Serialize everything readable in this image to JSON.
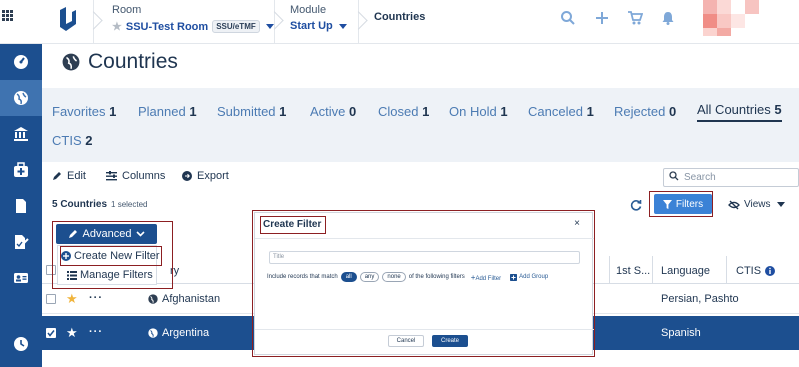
{
  "header": {
    "room_label": "Room",
    "room_value": "SSU-Test Room",
    "room_pill": "SSU/eTMF",
    "module_label": "Module",
    "module_value": "Start Up",
    "current": "Countries"
  },
  "page": {
    "title": "Countries"
  },
  "tabs": [
    {
      "label": "Favorites",
      "count": "1"
    },
    {
      "label": "Planned",
      "count": "1"
    },
    {
      "label": "Submitted",
      "count": "1"
    },
    {
      "label": "Active",
      "count": "0"
    },
    {
      "label": "Closed",
      "count": "1"
    },
    {
      "label": "On Hold",
      "count": "1"
    },
    {
      "label": "Canceled",
      "count": "1"
    },
    {
      "label": "Rejected",
      "count": "0"
    },
    {
      "label": "All Countries",
      "count": "5"
    },
    {
      "label": "CTIS",
      "count": "2"
    }
  ],
  "toolbar": {
    "edit": "Edit",
    "columns": "Columns",
    "export": "Export",
    "search_placeholder": "Search"
  },
  "list": {
    "count": "5 Countries",
    "selected": "1 selected",
    "filters_label": "Filters",
    "views_label": "Views",
    "advanced_label": "Advanced",
    "create_filter": "Create New Filter",
    "manage_filters": "Manage Filters"
  },
  "table": {
    "headers": {
      "country": "ry",
      "first": "1st S...",
      "language": "Language",
      "ctis": "CTIS"
    },
    "rows": [
      {
        "country": "Afghanistan",
        "language": "Persian, Pashto",
        "selected": false,
        "favorite": true
      },
      {
        "country": "Argentina",
        "language": "Spanish",
        "selected": true,
        "favorite": true
      }
    ]
  },
  "modal": {
    "title": "Create Filter",
    "close": "×",
    "title_placeholder": "Title",
    "match_prefix": "Include records that match",
    "opt_all": "all",
    "opt_any": "any",
    "opt_none": "none",
    "match_suffix": "of the following filters",
    "add_filter": "Add Filter",
    "add_group": "Add Group",
    "cancel": "Cancel",
    "create": "Create"
  },
  "colors": {
    "sidebar": "#1c4f8f",
    "accent": "#3b82d6",
    "highlight_box": "#8c1f22",
    "tab_bg": "#eef2f7"
  }
}
